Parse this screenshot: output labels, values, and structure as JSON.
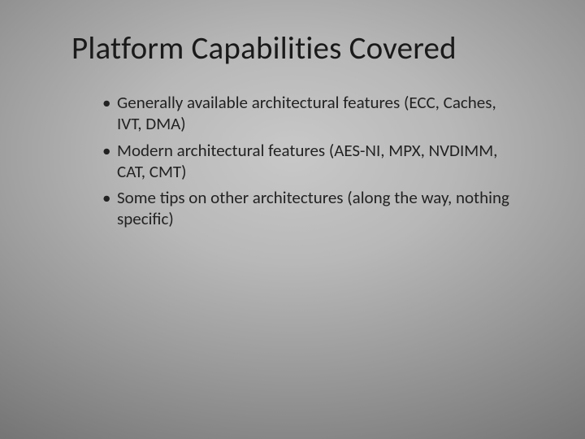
{
  "slide": {
    "title": "Platform Capabilities Covered",
    "bullets": [
      "Generally available architectural features (ECC, Caches, IVT, DMA)",
      "Modern architectural features (AES-NI, MPX, NVDIMM, CAT, CMT)",
      "Some tips on other architectures (along the way, nothing specific)"
    ]
  }
}
